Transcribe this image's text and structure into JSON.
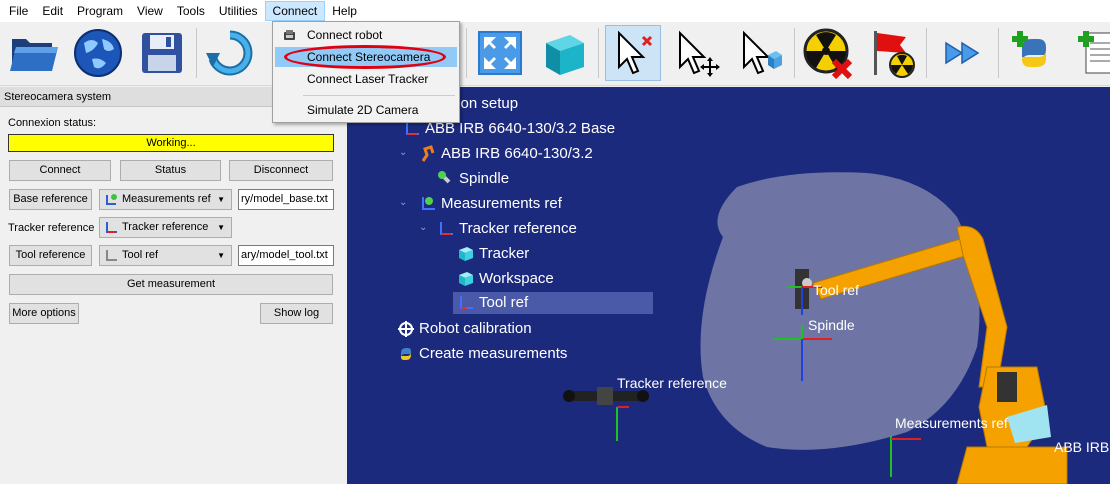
{
  "menubar": {
    "items": [
      "File",
      "Edit",
      "Program",
      "View",
      "Tools",
      "Utilities",
      "Connect",
      "Help"
    ]
  },
  "connect_menu": {
    "items": [
      "Connect robot",
      "Connect Stereocamera",
      "Connect Laser Tracker",
      "Simulate 2D Camera"
    ]
  },
  "panel": {
    "title": "Stereocamera system",
    "connexion_status_label": "Connexion status:",
    "status_text": "Working...",
    "connect_button": "Connect",
    "status_button": "Status",
    "disconnect_button": "Disconnect",
    "base_reference_button": "Base reference",
    "base_reference_combo": "Measurements ref",
    "base_reference_file": "ry/model_base.txt",
    "tracker_reference_label": "Tracker reference",
    "tracker_reference_combo": "Tracker reference",
    "tool_reference_button": "Tool reference",
    "tool_reference_combo": "Tool ref",
    "tool_reference_file": "ary/model_tool.txt",
    "get_measurement_button": "Get measurement",
    "more_options_button": "More options",
    "show_log_button": "Show log"
  },
  "tree": {
    "root": "tion setup",
    "items": [
      "ABB IRB 6640-130/3.2 Base",
      "ABB IRB 6640-130/3.2",
      "Spindle",
      "Measurements ref",
      "Tracker reference",
      "Tracker",
      "Workspace",
      "Tool ref",
      "Robot calibration",
      "Create measurements"
    ]
  },
  "viewport_labels": {
    "tool_ref": "Tool ref",
    "spindle": "Spindle",
    "tracker_reference": "Tracker reference",
    "measurements_ref": "Measurements ref",
    "abb": "ABB IRB"
  },
  "colors": {
    "viewport_bg": "#1c2a7e",
    "status_yellow": "#ffff00",
    "highlight_red": "#e00010",
    "robot_orange": "#f5a200"
  }
}
